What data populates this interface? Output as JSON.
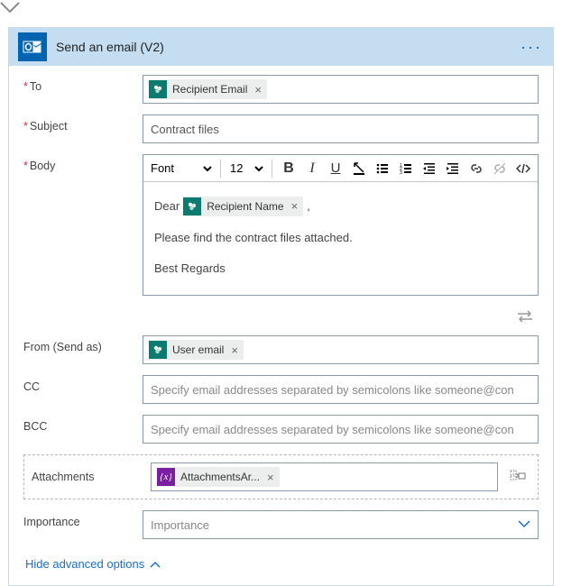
{
  "header": {
    "title": "Send an email (V2)"
  },
  "labels": {
    "to": "To",
    "subject": "Subject",
    "body": "Body",
    "from": "From (Send as)",
    "cc": "CC",
    "bcc": "BCC",
    "attachments": "Attachments",
    "importance": "Importance"
  },
  "tokens": {
    "recipient_email": "Recipient Email",
    "recipient_name": "Recipient Name",
    "user_email": "User email",
    "attachments_array": "AttachmentsAr..."
  },
  "subject_value": "Contract files",
  "rte": {
    "font_label": "Font",
    "size_label": "12",
    "dear": "Dear",
    "comma": ",",
    "line2": "Please find the contract files attached.",
    "line3": "Best Regards"
  },
  "placeholders": {
    "cc": "Specify email addresses separated by semicolons like someone@con",
    "bcc": "Specify email addresses separated by semicolons like someone@con",
    "importance": "Importance"
  },
  "advanced_link": "Hide advanced options"
}
